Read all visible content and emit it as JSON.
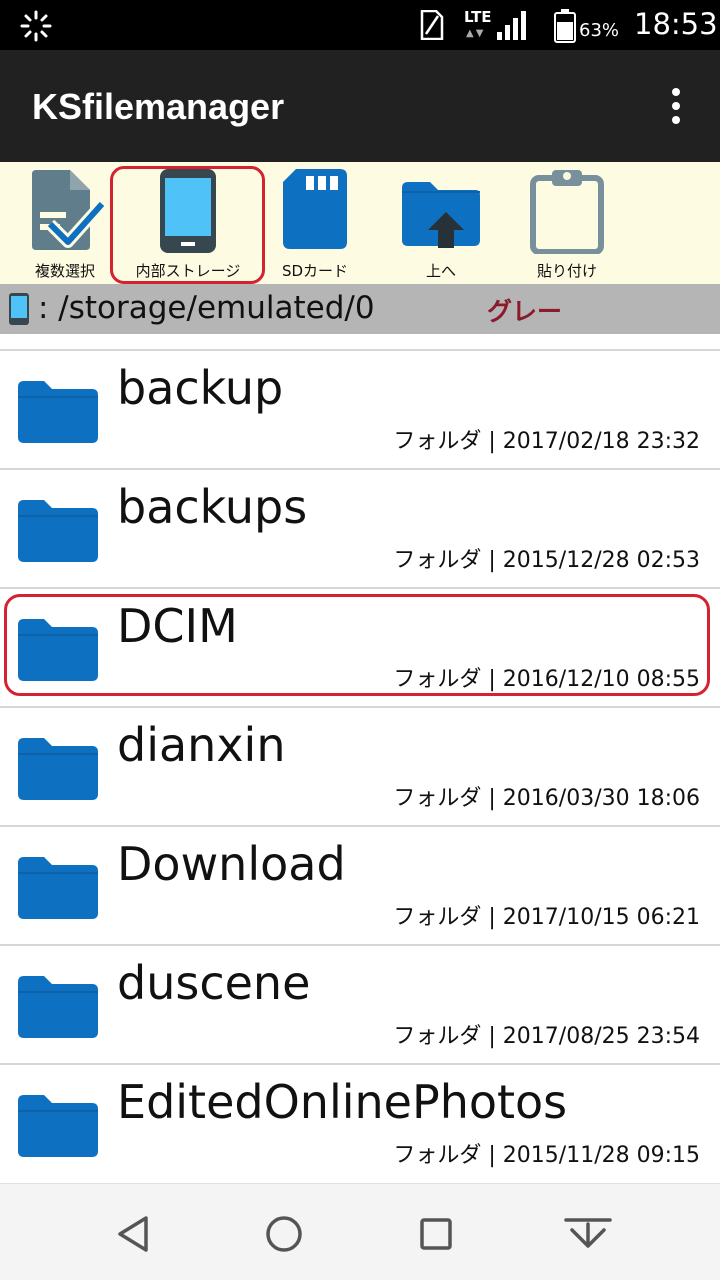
{
  "status_bar": {
    "network": "LTE",
    "battery_percent": "63%",
    "battery_level": 0.63,
    "time": "18:53",
    "icons": [
      "loading-icon",
      "sim-icon",
      "signal-icon",
      "battery-icon"
    ]
  },
  "app_bar": {
    "title": "KSfilemanager",
    "menu_icon": "overflow-menu-icon"
  },
  "toolbar": {
    "items": [
      {
        "label": "複数選択",
        "icon": "multi-select-icon"
      },
      {
        "label": "内部ストレージ",
        "icon": "phone-storage-icon"
      },
      {
        "label": "SDカード",
        "icon": "sd-card-icon"
      },
      {
        "label": "上へ",
        "icon": "folder-up-icon"
      },
      {
        "label": "貼り付け",
        "icon": "clipboard-icon"
      }
    ]
  },
  "path_bar": {
    "path": ": /storage/emulated/0",
    "note": "グレー"
  },
  "files": [
    {
      "name": "backup",
      "meta": "フォルダ | 2017/02/18 23:32"
    },
    {
      "name": "backups",
      "meta": "フォルダ | 2015/12/28 02:53"
    },
    {
      "name": "DCIM",
      "meta": "フォルダ | 2016/12/10 08:55"
    },
    {
      "name": "dianxin",
      "meta": "フォルダ | 2016/03/30 18:06"
    },
    {
      "name": "Download",
      "meta": "フォルダ | 2017/10/15 06:21"
    },
    {
      "name": "duscene",
      "meta": "フォルダ | 2017/08/25 23:54"
    },
    {
      "name": "EditedOnlinePhotos",
      "meta": "フォルダ | 2015/11/28 09:15"
    }
  ],
  "nav_bar": {
    "buttons": [
      "back-icon",
      "home-icon",
      "recents-icon",
      "notification-pull-icon"
    ]
  },
  "colors": {
    "folder_blue": "#0e70c0",
    "phone_screen": "#4fc3f7",
    "highlight_red": "#d42231",
    "toolbar_bg": "#fdfbe1",
    "path_bar_bg": "#b5b5b5",
    "app_bar_bg": "#212121"
  }
}
